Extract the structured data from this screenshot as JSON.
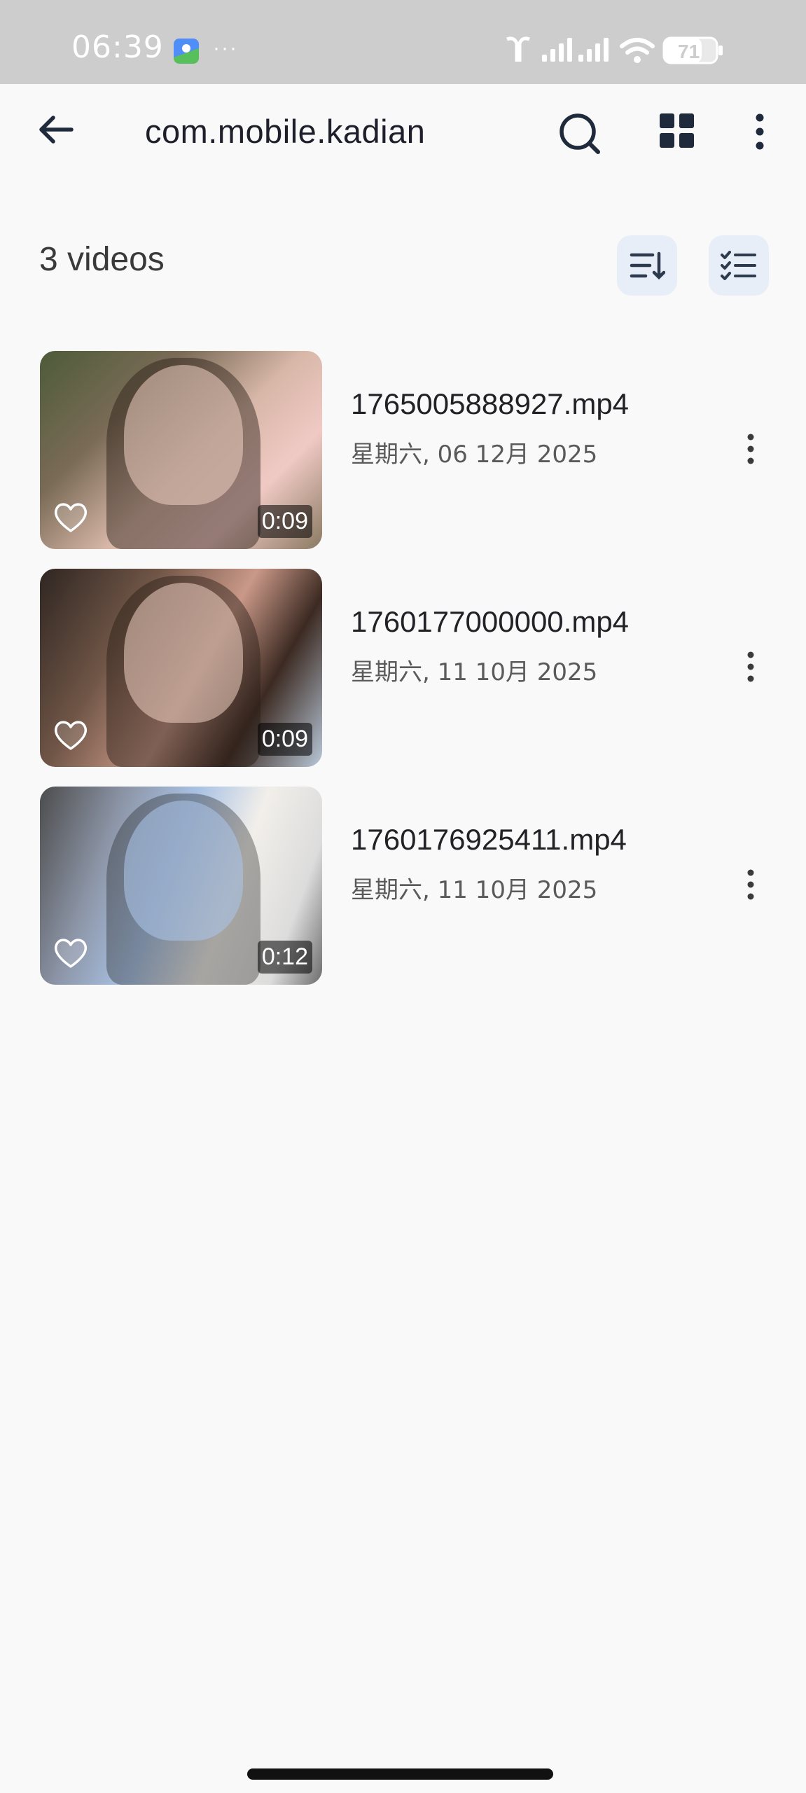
{
  "status_bar": {
    "time": "06:39",
    "dots": "···",
    "battery": "71"
  },
  "app_bar": {
    "title": "com.mobile.kadian"
  },
  "list_header": {
    "count_label": "3 videos"
  },
  "videos": [
    {
      "name": "1765005888927.mp4",
      "date": "星期六, 06 12月 2025",
      "duration": "0:09"
    },
    {
      "name": "1760177000000.mp4",
      "date": "星期六, 11 10月 2025",
      "duration": "0:09"
    },
    {
      "name": "1760176925411.mp4",
      "date": "星期六, 11 10月 2025",
      "duration": "0:12"
    }
  ],
  "colors": {
    "accent_bg": "#e8eef8",
    "icon_dark": "#1f2a3c"
  }
}
